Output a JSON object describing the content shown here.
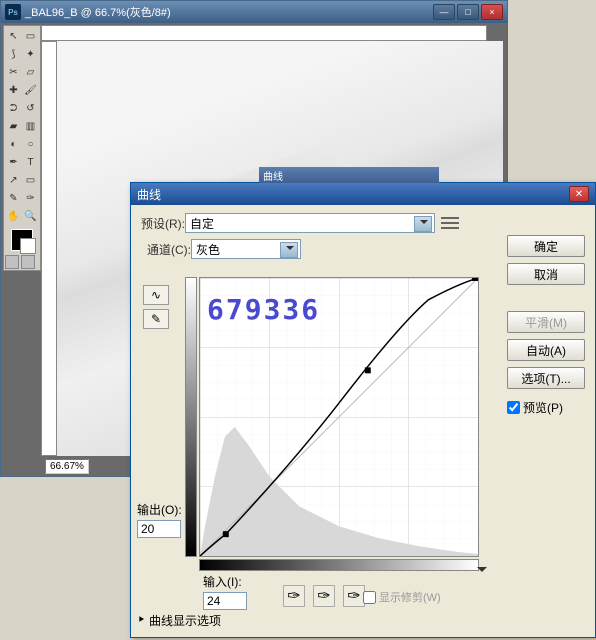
{
  "ps_window": {
    "app_icon": "Ps",
    "title": "_BAL96_B @ 66.7%(灰色/8#)",
    "zoom_status": "66.67%"
  },
  "dialog": {
    "inner_title": "曲线",
    "title": "曲线",
    "preset_label": "预设(R):",
    "preset_value": "自定",
    "channel_label": "通道(C):",
    "channel_value": "灰色",
    "output_label": "输出(O):",
    "output_value": "20",
    "input_label": "输入(I):",
    "input_value": "24",
    "clip_label": "显示修剪(W)",
    "display_opts": "曲线显示选项",
    "watermark": "679336",
    "buttons": {
      "ok": "确定",
      "cancel": "取消",
      "smooth": "平滑(M)",
      "auto": "自动(A)",
      "options": "选项(T)...",
      "preview": "预览(P)"
    }
  },
  "chart_data": {
    "type": "line",
    "title": "曲线",
    "xlabel": "输入",
    "ylabel": "输出",
    "xlim": [
      0,
      255
    ],
    "ylim": [
      0,
      255
    ],
    "series": [
      {
        "name": "baseline",
        "x": [
          0,
          255
        ],
        "y": [
          0,
          255
        ]
      },
      {
        "name": "curve",
        "x": [
          0,
          24,
          128,
          210,
          255
        ],
        "y": [
          0,
          20,
          140,
          235,
          255
        ]
      }
    ],
    "histogram_hint": "grayscale histogram skewed toward shadows, peak near 20-40, long tail to highlights"
  }
}
